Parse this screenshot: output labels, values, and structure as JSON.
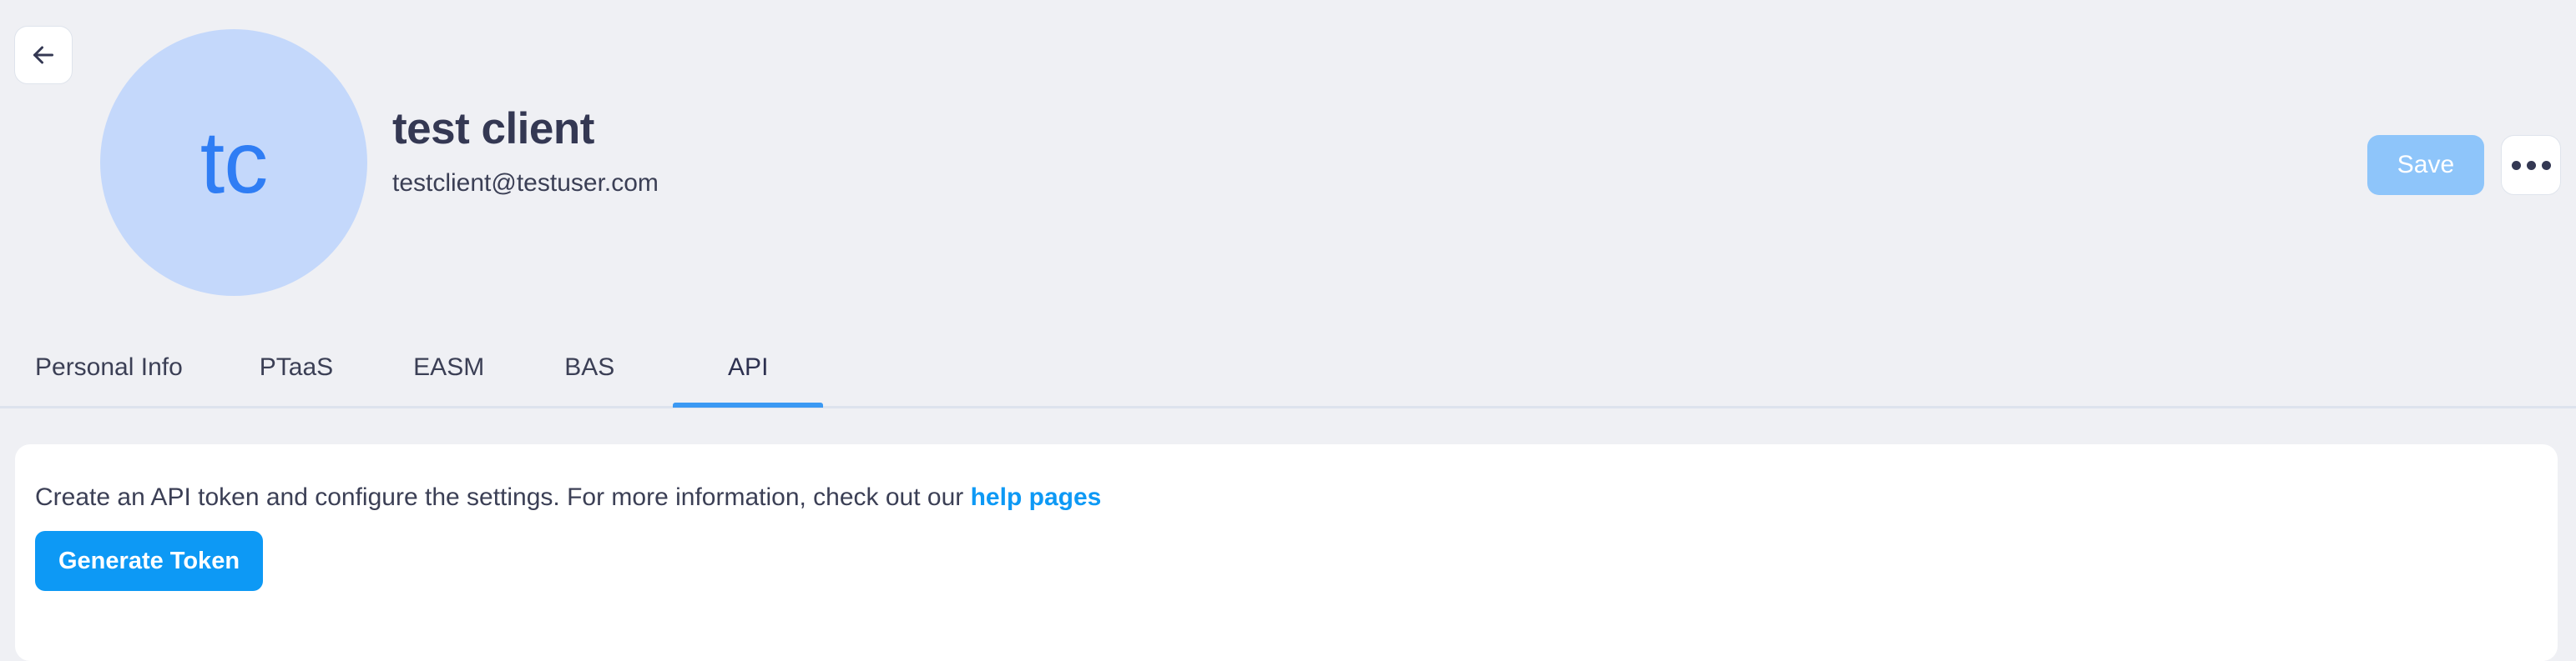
{
  "header": {
    "back_icon": "arrow-left-icon",
    "avatar": {
      "initials": "tc",
      "background_color": "#c4d8fb",
      "text_color": "#2f7df4"
    },
    "title": "test client",
    "email": "testclient@testuser.com",
    "actions": {
      "save_label": "Save",
      "save_disabled_color": "#8ec5fa",
      "more_icon": "ellipsis-horizontal-icon"
    }
  },
  "tabs": {
    "active_index": 4,
    "active_color": "#3b99f3",
    "items": [
      {
        "label": "Personal Info"
      },
      {
        "label": "PTaaS"
      },
      {
        "label": "EASM"
      },
      {
        "label": "BAS"
      },
      {
        "label": "API"
      }
    ]
  },
  "api_panel": {
    "description_prefix": "Create an API token and configure the settings. For more information, check out our ",
    "help_link_label": "help pages",
    "generate_token_label": "Generate Token",
    "accent_color": "#0d99f5"
  }
}
